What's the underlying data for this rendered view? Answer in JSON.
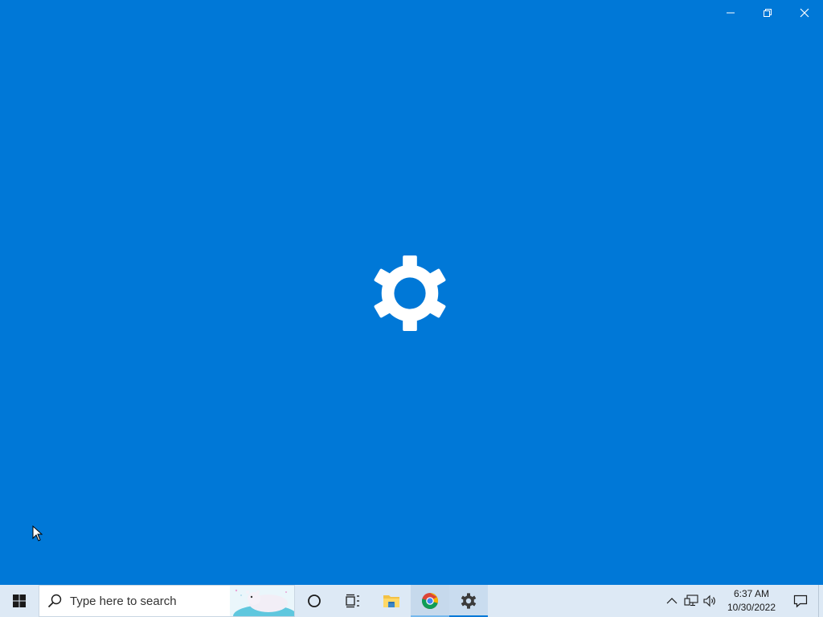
{
  "window": {
    "minimize_icon": "minimize-icon",
    "restore_icon": "restore-icon",
    "close_icon": "close-icon",
    "splash_icon": "gear-icon",
    "background_color": "#0078d7"
  },
  "taskbar": {
    "start_icon": "windows-logo-icon",
    "search": {
      "placeholder": "Type here to search"
    },
    "apps": [
      {
        "name": "cortana",
        "icon": "cortana-circle-icon"
      },
      {
        "name": "task-view",
        "icon": "task-view-icon"
      },
      {
        "name": "file-explorer",
        "icon": "folder-icon"
      },
      {
        "name": "chrome",
        "icon": "chrome-icon"
      },
      {
        "name": "settings",
        "icon": "gear-icon"
      }
    ],
    "tray": {
      "chevron_icon": "chevron-up-icon",
      "network_icon": "network-icon",
      "volume_icon": "volume-icon",
      "time": "6:37 AM",
      "date": "10/30/2022",
      "notification_icon": "action-center-icon"
    },
    "colors": {
      "background": "#dde9f5",
      "accent": "#0078d7"
    }
  }
}
